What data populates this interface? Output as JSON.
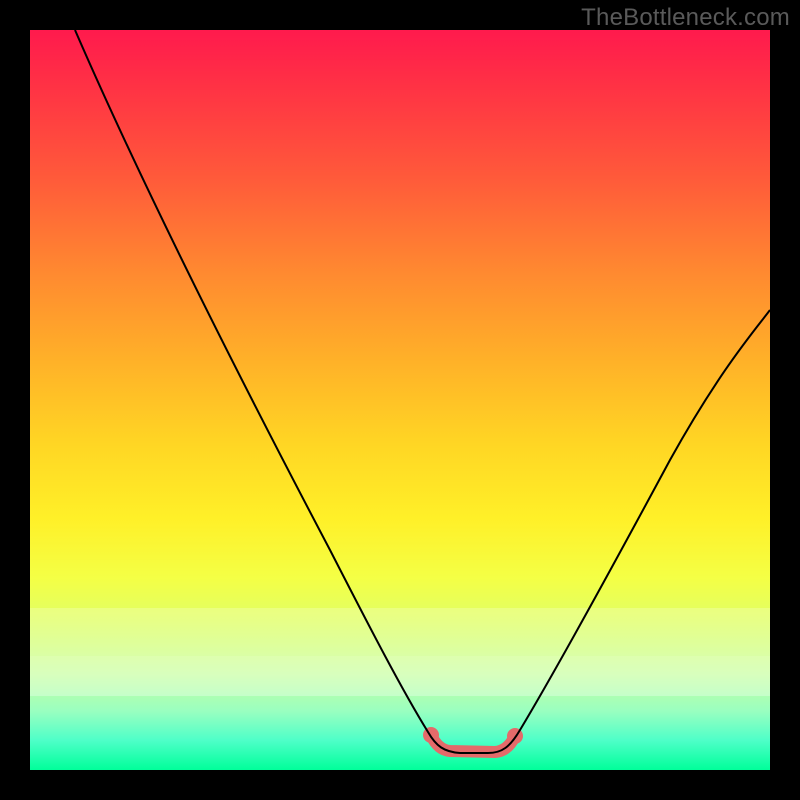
{
  "watermark": "TheBottleneck.com",
  "colors": {
    "frame_background": "#000000",
    "curve_stroke": "#000000",
    "highlight_stroke": "#e46a6a",
    "gradient_top": "#ff1a4d",
    "gradient_bottom": "#00ff9a",
    "watermark_color": "#5a5a5a"
  },
  "chart_data": {
    "type": "line",
    "title": "",
    "xlabel": "",
    "ylabel": "",
    "xlim": [
      0,
      100
    ],
    "ylim": [
      0,
      100
    ],
    "grid": false,
    "legend": false,
    "description": "Bottleneck-style V-curve on a vertical red→green gradient. Left branch descends from top-left to valley; right branch rises to mid-right. Salmon band highlights the flat minimum.",
    "series": [
      {
        "name": "left-branch",
        "x": [
          6,
          15,
          25,
          35,
          45,
          52,
          55
        ],
        "y": [
          100,
          82,
          63,
          44,
          25,
          10,
          3
        ]
      },
      {
        "name": "valley",
        "x": [
          55,
          58,
          62,
          65
        ],
        "y": [
          3,
          1,
          1,
          3
        ]
      },
      {
        "name": "right-branch",
        "x": [
          65,
          72,
          80,
          88,
          96,
          100
        ],
        "y": [
          3,
          13,
          27,
          42,
          57,
          63
        ]
      }
    ],
    "highlight_region": {
      "x": [
        54,
        66
      ],
      "y_approx": 2
    },
    "background_gradient_stops": [
      {
        "pct": 0,
        "color": "#ff1a4d"
      },
      {
        "pct": 33,
        "color": "#ff8a30"
      },
      {
        "pct": 66,
        "color": "#fff028"
      },
      {
        "pct": 100,
        "color": "#00ff9a"
      }
    ]
  }
}
